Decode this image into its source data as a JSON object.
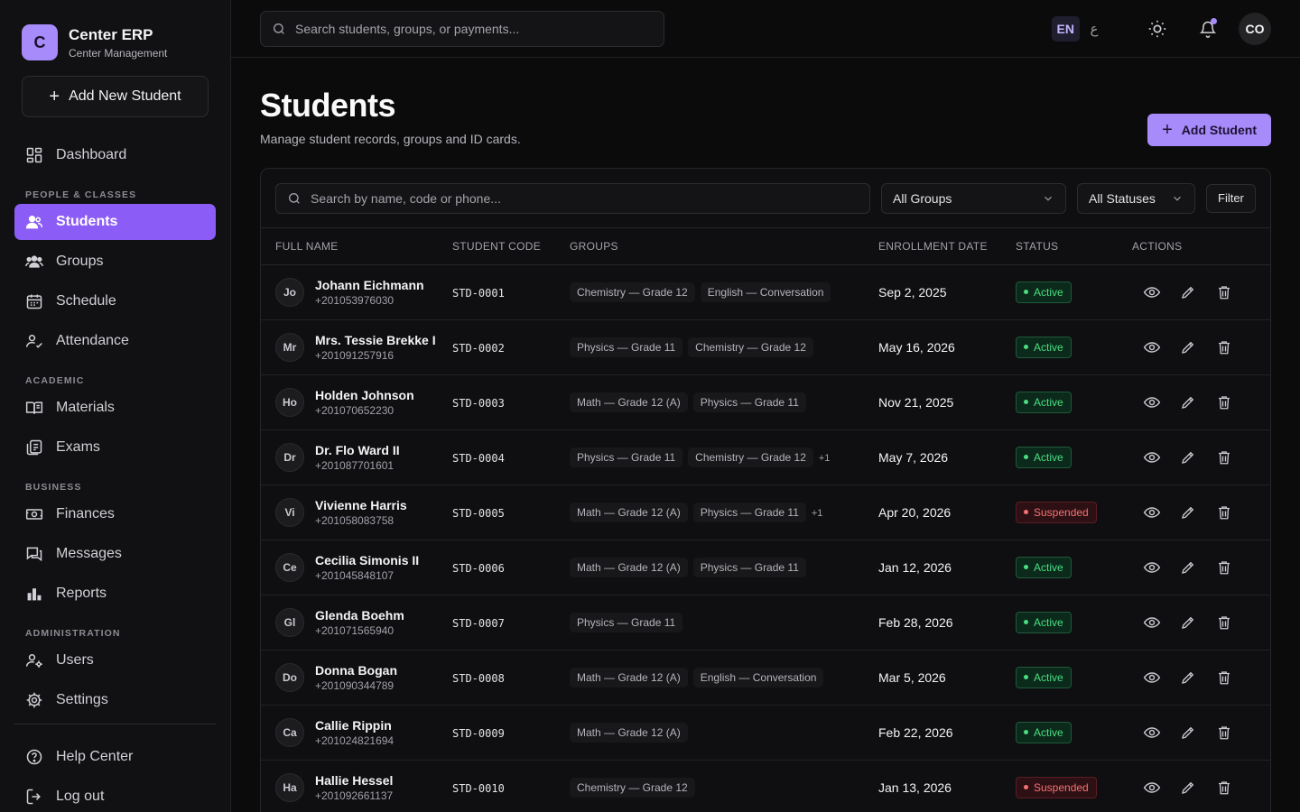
{
  "brand": {
    "logo_letter": "C",
    "name": "Center ERP",
    "subtitle": "Center Management"
  },
  "sidebar": {
    "add_new_label": "Add New Student",
    "items": [
      {
        "label": "Dashboard",
        "icon": "dashboard-icon"
      },
      {
        "section": "PEOPLE & CLASSES"
      },
      {
        "label": "Students",
        "icon": "users-icon",
        "active": true
      },
      {
        "label": "Groups",
        "icon": "groups-icon"
      },
      {
        "label": "Schedule",
        "icon": "calendar-icon"
      },
      {
        "label": "Attendance",
        "icon": "user-check-icon"
      },
      {
        "section": "ACADEMIC"
      },
      {
        "label": "Materials",
        "icon": "book-icon"
      },
      {
        "label": "Exams",
        "icon": "exam-icon"
      },
      {
        "section": "BUSINESS"
      },
      {
        "label": "Finances",
        "icon": "money-icon"
      },
      {
        "label": "Messages",
        "icon": "messages-icon"
      },
      {
        "label": "Reports",
        "icon": "bar-chart-icon"
      },
      {
        "section": "ADMINISTRATION"
      },
      {
        "label": "Users",
        "icon": "users-cog-icon"
      },
      {
        "label": "Settings",
        "icon": "gear-icon"
      }
    ],
    "bottom": [
      {
        "label": "Help Center",
        "icon": "help-icon"
      },
      {
        "label": "Log out",
        "icon": "logout-icon"
      }
    ]
  },
  "topbar": {
    "search_placeholder": "Search students, groups, or payments...",
    "lang_active": "EN",
    "lang_alt": "ع",
    "user_initials": "CO"
  },
  "page": {
    "title": "Students",
    "subtitle": "Manage student records, groups and ID cards.",
    "add_button": "Add Student"
  },
  "filters": {
    "search_placeholder": "Search by name, code or phone...",
    "groups_select": "All Groups",
    "status_select": "All Statuses",
    "filter_button": "Filter"
  },
  "table": {
    "headers": [
      "FULL NAME",
      "STUDENT CODE",
      "GROUPS",
      "ENROLLMENT DATE",
      "STATUS",
      "ACTIONS"
    ],
    "rows": [
      {
        "initials": "Jo",
        "name": "Johann Eichmann",
        "phone": "+201053976030",
        "code": "STD-0001",
        "groups": [
          "Chemistry — Grade 12",
          "English — Conversation"
        ],
        "more": "",
        "date": "Sep 2, 2025",
        "status": "Active"
      },
      {
        "initials": "Mr",
        "name": "Mrs. Tessie Brekke I",
        "phone": "+201091257916",
        "code": "STD-0002",
        "groups": [
          "Physics — Grade 11",
          "Chemistry — Grade 12"
        ],
        "more": "",
        "date": "May 16, 2026",
        "status": "Active"
      },
      {
        "initials": "Ho",
        "name": "Holden Johnson",
        "phone": "+201070652230",
        "code": "STD-0003",
        "groups": [
          "Math — Grade 12 (A)",
          "Physics — Grade 11"
        ],
        "more": "",
        "date": "Nov 21, 2025",
        "status": "Active"
      },
      {
        "initials": "Dr",
        "name": "Dr. Flo Ward II",
        "phone": "+201087701601",
        "code": "STD-0004",
        "groups": [
          "Physics — Grade 11",
          "Chemistry — Grade 12"
        ],
        "more": "+1",
        "date": "May 7, 2026",
        "status": "Active"
      },
      {
        "initials": "Vi",
        "name": "Vivienne Harris",
        "phone": "+201058083758",
        "code": "STD-0005",
        "groups": [
          "Math — Grade 12 (A)",
          "Physics — Grade 11"
        ],
        "more": "+1",
        "date": "Apr 20, 2026",
        "status": "Suspended"
      },
      {
        "initials": "Ce",
        "name": "Cecilia Simonis II",
        "phone": "+201045848107",
        "code": "STD-0006",
        "groups": [
          "Math — Grade 12 (A)",
          "Physics — Grade 11"
        ],
        "more": "",
        "date": "Jan 12, 2026",
        "status": "Active"
      },
      {
        "initials": "Gl",
        "name": "Glenda Boehm",
        "phone": "+201071565940",
        "code": "STD-0007",
        "groups": [
          "Physics — Grade 11"
        ],
        "more": "",
        "date": "Feb 28, 2026",
        "status": "Active"
      },
      {
        "initials": "Do",
        "name": "Donna Bogan",
        "phone": "+201090344789",
        "code": "STD-0008",
        "groups": [
          "Math — Grade 12 (A)",
          "English — Conversation"
        ],
        "more": "",
        "date": "Mar 5, 2026",
        "status": "Active"
      },
      {
        "initials": "Ca",
        "name": "Callie Rippin",
        "phone": "+201024821694",
        "code": "STD-0009",
        "groups": [
          "Math — Grade 12 (A)"
        ],
        "more": "",
        "date": "Feb 22, 2026",
        "status": "Active"
      },
      {
        "initials": "Ha",
        "name": "Hallie Hessel",
        "phone": "+201092661137",
        "code": "STD-0010",
        "groups": [
          "Chemistry — Grade 12"
        ],
        "more": "",
        "date": "Jan 13, 2026",
        "status": "Suspended"
      }
    ]
  },
  "colors": {
    "accent": "#a78bfa",
    "accent_strong": "#8b5cf6",
    "active": "#4ade80",
    "suspended": "#f87171"
  }
}
